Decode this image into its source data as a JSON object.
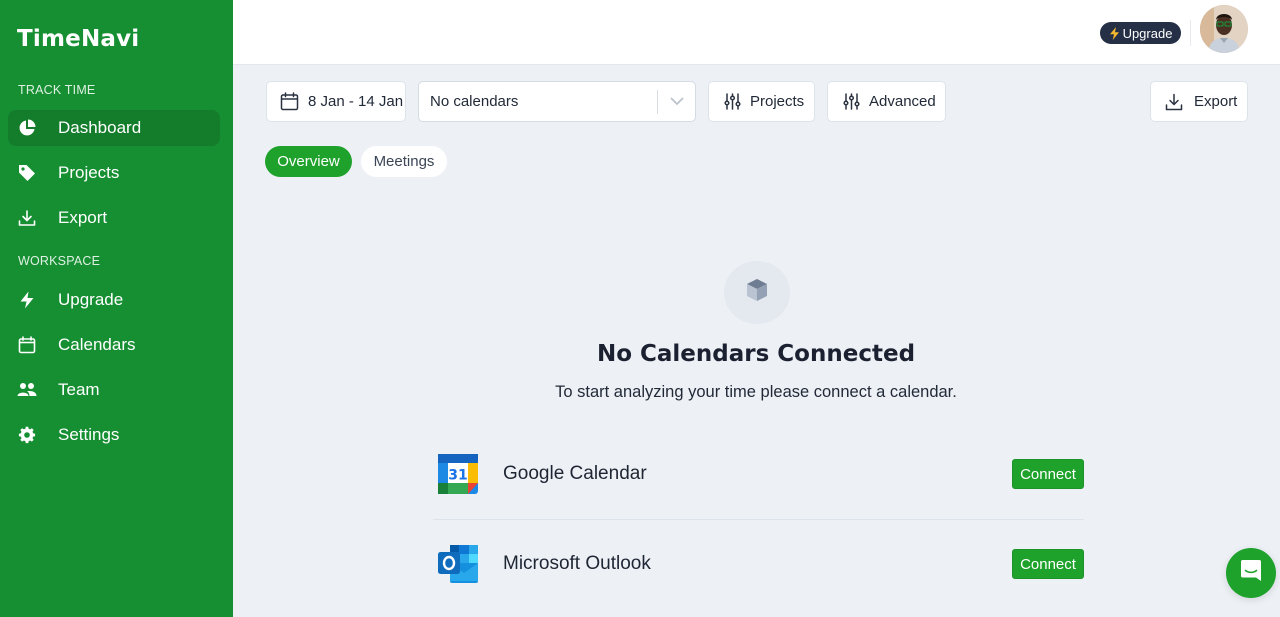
{
  "app": {
    "name": "TimeNavi"
  },
  "sidebar": {
    "sections": [
      {
        "label": "TRACK TIME",
        "items": [
          {
            "label": "Dashboard",
            "icon": "pie-chart-icon",
            "active": true
          },
          {
            "label": "Projects",
            "icon": "tag-icon",
            "active": false
          },
          {
            "label": "Export",
            "icon": "download-icon",
            "active": false
          }
        ]
      },
      {
        "label": "WORKSPACE",
        "items": [
          {
            "label": "Upgrade",
            "icon": "lightning-icon",
            "active": false
          },
          {
            "label": "Calendars",
            "icon": "calendar-icon",
            "active": false
          },
          {
            "label": "Team",
            "icon": "users-icon",
            "active": false
          },
          {
            "label": "Settings",
            "icon": "gear-icon",
            "active": false
          }
        ]
      }
    ]
  },
  "header": {
    "upgrade_label": "Upgrade",
    "upgrade_icon": "lightning-icon",
    "avatar_alt": "User avatar"
  },
  "toolbar": {
    "date_range": "8 Jan - 14 Jan",
    "calendar_select": {
      "value": "No calendars"
    },
    "projects_label": "Projects",
    "advanced_label": "Advanced",
    "export_label": "Export"
  },
  "tabs": [
    {
      "label": "Overview",
      "active": true
    },
    {
      "label": "Meetings",
      "active": false
    }
  ],
  "empty_state": {
    "icon": "cube-icon",
    "title": "No Calendars Connected",
    "subtitle": "To start analyzing your time please connect a calendar."
  },
  "providers": [
    {
      "name": "Google Calendar",
      "icon": "google-calendar-icon",
      "action": "Connect"
    },
    {
      "name": "Microsoft Outlook",
      "icon": "outlook-icon",
      "action": "Connect"
    }
  ],
  "colors": {
    "sidebar_bg": "#168f33",
    "sidebar_active_bg": "#137d2b",
    "accent": "#1ea22b",
    "page_bg": "#edf1f6",
    "upgrade_pill_bg": "#253046"
  },
  "chat_widget": {
    "icon": "chat-icon"
  }
}
